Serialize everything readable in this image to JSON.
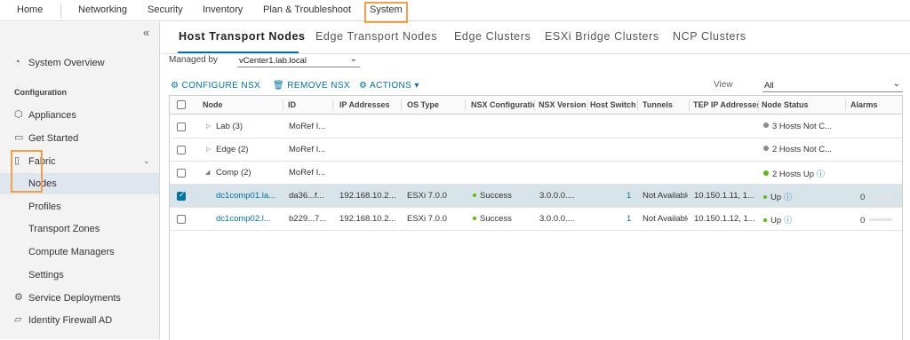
{
  "topnav": {
    "tabs": [
      "Home",
      "Networking",
      "Security",
      "Inventory",
      "Plan & Troubleshoot",
      "System"
    ],
    "active": "System"
  },
  "sidebar": {
    "collapse_icon": "double-chevron-left-icon",
    "items": [
      {
        "label": "System Overview",
        "icon": "gauge-icon"
      },
      {
        "label": "Configuration"
      },
      {
        "label": "Appliances",
        "icon": "cube-icon"
      },
      {
        "label": "Get Started",
        "icon": "monitor-icon"
      },
      {
        "label": "Fabric",
        "icon": "server-icon"
      },
      {
        "label": "Nodes"
      },
      {
        "label": "Profiles"
      },
      {
        "label": "Transport Zones"
      },
      {
        "label": "Compute Managers"
      },
      {
        "label": "Settings"
      },
      {
        "label": "Service Deployments",
        "icon": "deploy-icon"
      },
      {
        "label": "Identity Firewall AD",
        "icon": "folder-icon"
      }
    ]
  },
  "subtabs": [
    "Host Transport Nodes",
    "Edge Transport Nodes",
    "Edge Clusters",
    "ESXi Bridge Clusters",
    "NCP Clusters"
  ],
  "managed_by": {
    "label": "Managed by",
    "value": "vCenter1.lab.local"
  },
  "actions": {
    "configure": "CONFIGURE NSX",
    "remove": "REMOVE NSX",
    "actions": "ACTIONS"
  },
  "view": {
    "label": "View",
    "value": "All"
  },
  "table": {
    "columns": [
      "Node",
      "ID",
      "IP Addresses",
      "OS Type",
      "NSX Configuration",
      "NSX Version",
      "Host Switch",
      "Tunnels",
      "TEP IP Addresses",
      "Node Status",
      "Alarms"
    ],
    "rows": [
      {
        "node": "Lab (3)",
        "id": "MoRef I...",
        "status": "3 Hosts Not C...",
        "status_color": "#8c8c8c"
      },
      {
        "node": "Edge (2)",
        "id": "MoRef I...",
        "status": "2 Hosts Not C...",
        "status_color": "#8c8c8c"
      },
      {
        "node": "Comp (2)",
        "id": "MoRef I...",
        "status": "2 Hosts Up",
        "status_color": "#5eb715"
      },
      {
        "node": "dc1comp01.la...",
        "id": "da36...f...",
        "ip": "192.168.10.2...",
        "os": "ESXi 7.0.0",
        "config": "Success",
        "version": "3.0.0.0....",
        "switch": "1",
        "tunnels": "Not Available",
        "tep": "10.150.1.11, 1...",
        "status": "Up",
        "alarms": "0",
        "status_color": "#5eb715"
      },
      {
        "node": "dc1comp02.l...",
        "id": "b229...7...",
        "ip": "192.168.10.2...",
        "os": "ESXi 7.0.0",
        "config": "Success",
        "version": "3.0.0.0....",
        "switch": "1",
        "tunnels": "Not Available",
        "tep": "10.150.1.12, 1...",
        "status": "Up",
        "alarms": "0",
        "status_color": "#5eb715"
      }
    ]
  },
  "colors": {
    "accent": "#0072a3",
    "highlight": "#f0a04b",
    "success": "#5eb715",
    "unknown": "#8c8c8c"
  }
}
